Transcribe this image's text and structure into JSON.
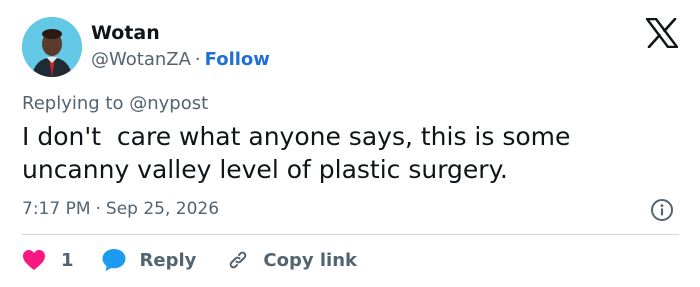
{
  "author": {
    "name": "Wotan",
    "handle": "@WotanZA",
    "separator": "·",
    "follow_label": "Follow"
  },
  "reply_to": {
    "prefix": "Replying to ",
    "handle": "@nypost"
  },
  "tweet": {
    "text": "I don't  care what anyone says, this is some uncanny valley level of plastic surgery."
  },
  "meta": {
    "time": "7:17 PM",
    "separator": "·",
    "date": "Sep 25, 2026"
  },
  "actions": {
    "like_count": "1",
    "reply_label": "Reply",
    "copy_label": "Copy link"
  },
  "icons": {
    "logo": "x-logo-icon",
    "info": "info-icon",
    "like": "heart-icon",
    "reply": "speech-bubble-icon",
    "copy": "link-icon"
  },
  "colors": {
    "text": "#0f1419",
    "secondary": "#536471",
    "follow": "#1d70d6",
    "like": "#f91880",
    "reply": "#1d9bf0",
    "avatar_bg": "#63c7e6"
  }
}
